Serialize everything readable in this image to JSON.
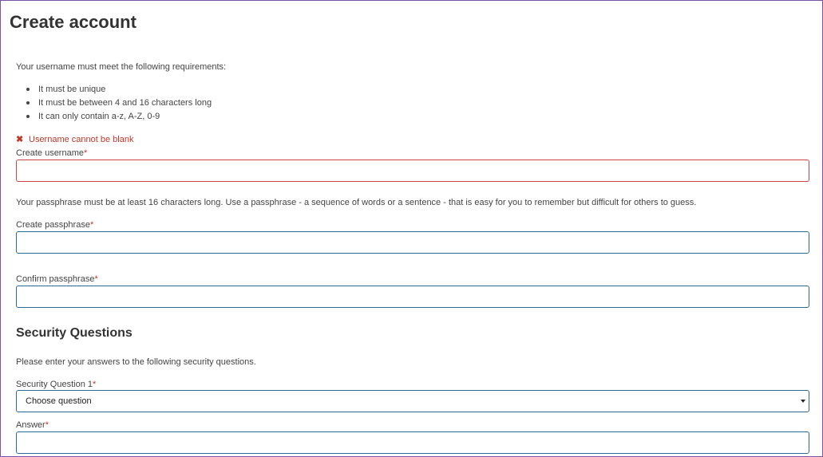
{
  "page": {
    "title": "Create account"
  },
  "username": {
    "intro": "Your username must meet the following requirements:",
    "requirements": [
      "It must be unique",
      "It must be between 4 and 16 characters long",
      "It can only contain a-z, A-Z, 0-9"
    ],
    "error": "Username cannot be blank",
    "label": "Create username",
    "value": ""
  },
  "passphrase": {
    "intro": "Your passphrase must be at least 16 characters long. Use a passphrase - a sequence of words or a sentence - that is easy for you to remember but difficult for others to guess.",
    "create_label": "Create passphrase",
    "create_value": "",
    "confirm_label": "Confirm passphrase",
    "confirm_value": ""
  },
  "security": {
    "title": "Security Questions",
    "intro": "Please enter your answers to the following security questions.",
    "question1_label": "Security Question 1",
    "question1_selected": "Choose question",
    "answer_label": "Answer",
    "answer_value": ""
  },
  "required_marker": "*",
  "colors": {
    "error": "#c0392b",
    "input_border": "#2b6a94",
    "frame_border": "#7b52a6"
  }
}
